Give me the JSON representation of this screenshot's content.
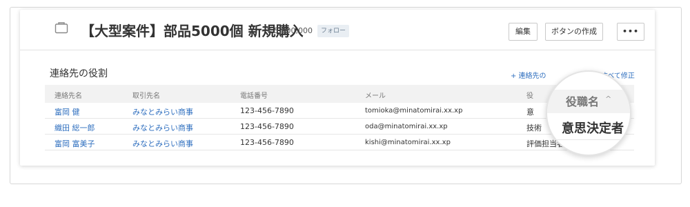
{
  "header": {
    "title": "【大型案件】部品5000個 新規購入",
    "amount": "- ¥ 5,000,000",
    "follow_label": "フォロー",
    "edit_label": "編集",
    "create_button_label": "ボタンの作成",
    "more_label": "•••"
  },
  "section": {
    "title": "連絡先の役割",
    "add_link": "+ 連絡先の",
    "edit_all_link": "すべて修正"
  },
  "table": {
    "columns": [
      "連絡先名",
      "取引先名",
      "電話番号",
      "メール",
      "役"
    ],
    "rows": [
      {
        "name": "富岡 健",
        "account": "みなとみらい商事",
        "phone": "123-456-7890",
        "email": "tomioka@minatomirai.xx.xp",
        "role": "意"
      },
      {
        "name": "織田 総一郎",
        "account": "みなとみらい商事",
        "phone": "123-456-7890",
        "email": "oda@minatomirai.xx.xp",
        "role": "技術"
      },
      {
        "name": "富岡 富美子",
        "account": "みなとみらい商事",
        "phone": "123-456-7890",
        "email": "kishi@minatomirai.xx.xp",
        "role": "評価担当者"
      }
    ]
  },
  "magnifier": {
    "column_label": "役職名",
    "chevron": "^",
    "value": "意思決定者"
  }
}
